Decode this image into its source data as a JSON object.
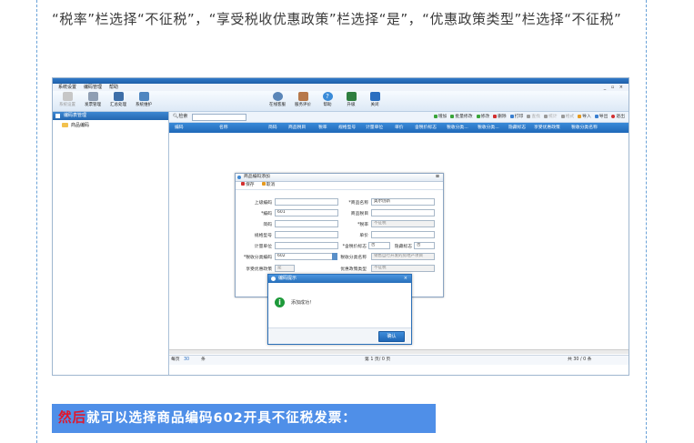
{
  "article": {
    "paragraph": "“税率”栏选择“不征税”，“享受税收优惠政策”栏选择“是”，“优惠政策类型”栏选择“不征税”",
    "banner_highlight": "然后",
    "banner_text": "就可以选择商品编码602开具不征税发票："
  },
  "app": {
    "menu": [
      "系统设置",
      "编码管理",
      "帮助"
    ],
    "window_controls": "_ ▫ ×",
    "toolbar_left": [
      {
        "label": "系统设置",
        "icon": "gear-icon",
        "disabled": true
      },
      {
        "label": "发票管理",
        "icon": "invoice-icon",
        "disabled": false
      },
      {
        "label": "汇总处理",
        "icon": "monitor-icon",
        "disabled": false
      },
      {
        "label": "系统维护",
        "icon": "maintenance-icon",
        "disabled": false
      }
    ],
    "toolbar_right": [
      {
        "label": "在线客服",
        "icon": "service-icon"
      },
      {
        "label": "服务评价",
        "icon": "rating-icon"
      },
      {
        "label": "帮助",
        "icon": "help-icon"
      },
      {
        "label": "升级",
        "icon": "upgrade-icon"
      },
      {
        "label": "关闭",
        "icon": "close-arrow-icon"
      }
    ],
    "left_panel": {
      "title": "编码表管理",
      "tree_item": "商品编码"
    },
    "search": {
      "label": "检索"
    },
    "actions": [
      {
        "label": "增加",
        "color": "#3aa53a",
        "disabled": false
      },
      {
        "label": "批量修改",
        "color": "#3aa53a",
        "disabled": false
      },
      {
        "label": "修改",
        "color": "#3aa53a",
        "disabled": false
      },
      {
        "label": "删除",
        "color": "#d23030",
        "disabled": false
      },
      {
        "label": "打印",
        "color": "#3a7fd0",
        "disabled": false
      },
      {
        "label": "查找",
        "color": "#9a9a9a",
        "disabled": true
      },
      {
        "label": "统计",
        "color": "#9a9a9a",
        "disabled": true
      },
      {
        "label": "格式",
        "color": "#9a9a9a",
        "disabled": true
      },
      {
        "label": "导入",
        "color": "#e69a1f",
        "disabled": false
      },
      {
        "label": "导出",
        "color": "#3a7fd0",
        "disabled": false
      },
      {
        "label": "退出",
        "color": "#d23030",
        "disabled": false
      }
    ],
    "columns": [
      "编码",
      "名称",
      "简码",
      "商品税目",
      "税率",
      "规格型号",
      "计量单位",
      "单价",
      "含税价标志",
      "税收分类...",
      "税收分类...",
      "隐藏标志",
      "享受优惠政策",
      "税收分类名称"
    ],
    "pager": {
      "left": "每页",
      "left_num": "30",
      "left_unit": "条",
      "page": "第  1  页/  0  页",
      "right": "共  30  /  0  条"
    }
  },
  "dialog_edit": {
    "title": "商品编码添加",
    "buttons": [
      "保存",
      "取消"
    ],
    "close": "⊠",
    "left_fields": [
      {
        "label": "上级编码",
        "value": ""
      },
      {
        "label": "*编码",
        "value": "601"
      },
      {
        "label": "简码",
        "value": ""
      },
      {
        "label": "规格型号",
        "value": ""
      },
      {
        "label": "计量单位",
        "value": ""
      },
      {
        "label": "*税收分类编码",
        "value": "602"
      },
      {
        "label": "享受优惠政策",
        "value": "是"
      }
    ],
    "right_fields": [
      {
        "label": "*商品名称",
        "value": "奥尔创新"
      },
      {
        "label": "商品税目",
        "value": ""
      },
      {
        "label": "*税率",
        "value": "不征税"
      },
      {
        "label": "单价",
        "value": ""
      },
      {
        "label": "*含税价标志",
        "value": "否"
      },
      {
        "label": "隐藏标志",
        "value": "否"
      },
      {
        "label": "税收分类名称",
        "value": "销售自行开发的房地产项目"
      },
      {
        "label": "优惠政策类型",
        "value": "不征税"
      }
    ]
  },
  "dialog_ok": {
    "title": "编码提示",
    "close": "×",
    "message": "添加成功！",
    "ok": "确认"
  }
}
